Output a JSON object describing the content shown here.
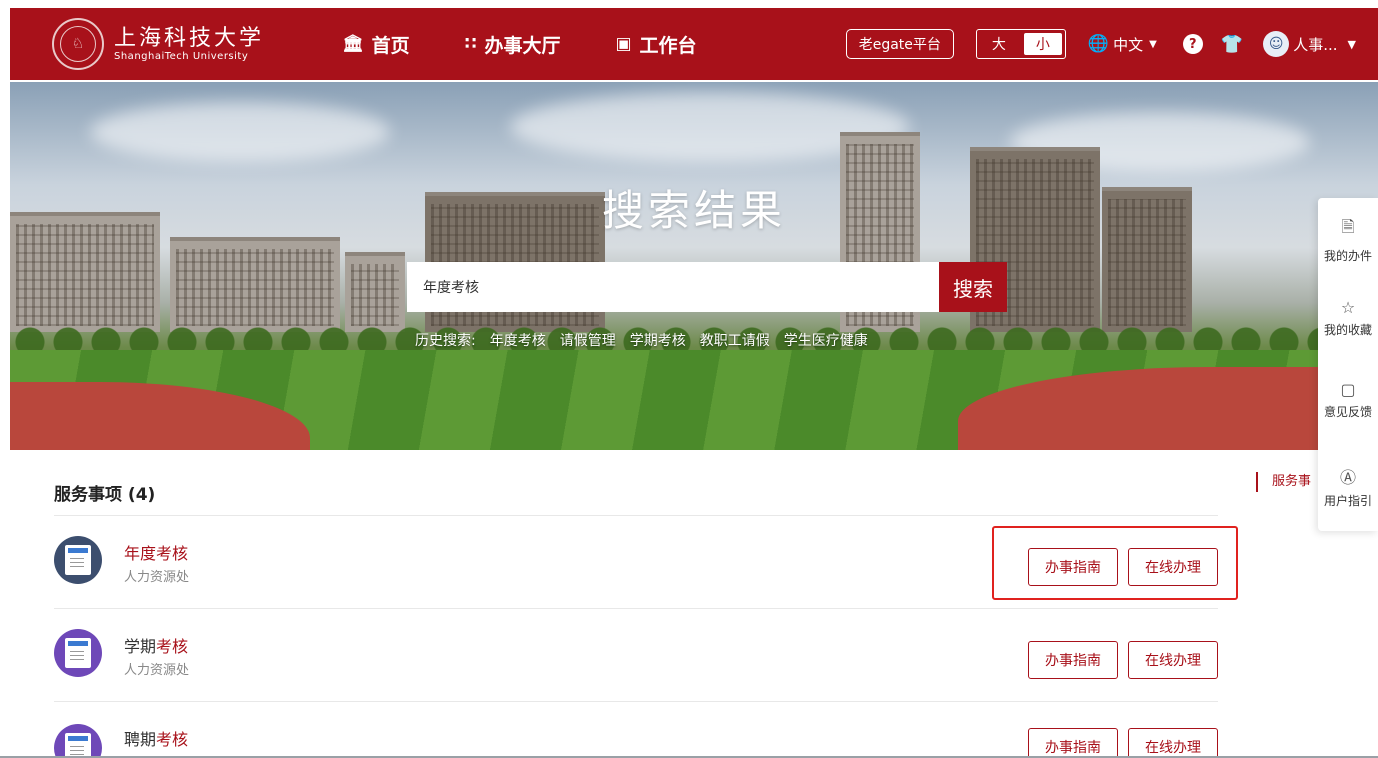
{
  "header": {
    "logo_cn": "上海科技大学",
    "logo_en": "ShanghaiTech University",
    "nav": [
      {
        "icon": "institution-icon",
        "label": "首页"
      },
      {
        "icon": "grid-icon",
        "label": "办事大厅"
      },
      {
        "icon": "monitor-icon",
        "label": "工作台"
      }
    ],
    "egate_label": "老egate平台",
    "size_big": "大",
    "size_small": "小",
    "language": "中文",
    "user_name": "人事..."
  },
  "hero": {
    "title": "搜索结果",
    "search_value": "年度考核",
    "search_button": "搜索",
    "history_label": "历史搜索:",
    "history": [
      "年度考核",
      "请假管理",
      "学期考核",
      "教职工请假",
      "学生医疗健康"
    ]
  },
  "side_panel": {
    "items": [
      {
        "icon": "document-icon",
        "label": "我的办件"
      },
      {
        "icon": "star-icon",
        "label": "我的收藏"
      },
      {
        "icon": "feedback-icon",
        "label": "意见反馈"
      },
      {
        "icon": "guide-icon",
        "label": "用户指引"
      }
    ]
  },
  "anchor": "服务事",
  "services": {
    "title": "服务事项",
    "count": "(4)",
    "items": [
      {
        "title": "年度考核",
        "title_plain": "",
        "dept": "人力资源处",
        "guide": "办事指南",
        "apply": "在线办理"
      },
      {
        "title_plain": "学期",
        "title": "考核",
        "dept": "人力资源处",
        "guide": "办事指南",
        "apply": "在线办理"
      },
      {
        "title_plain": "聘期",
        "title": "考核",
        "dept": "",
        "guide": "办事指南",
        "apply": "在线办理"
      }
    ]
  },
  "colors": {
    "brand": "#a8111a",
    "highlight": "#e0221f"
  }
}
